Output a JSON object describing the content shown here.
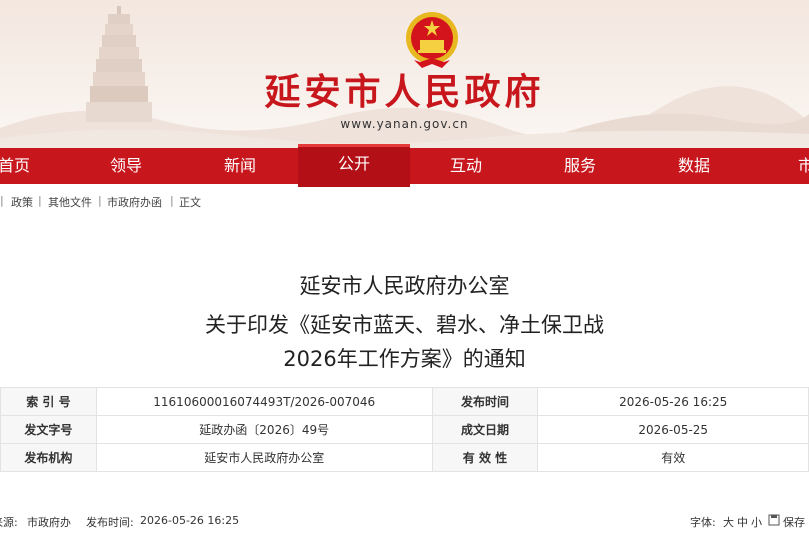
{
  "header": {
    "site_title": "延安市人民政府",
    "site_url": "www.yanan.gov.cn"
  },
  "nav": {
    "items": [
      {
        "label": "首页"
      },
      {
        "label": "领导"
      },
      {
        "label": "新闻"
      },
      {
        "label": "公开",
        "active": true
      },
      {
        "label": "互动"
      },
      {
        "label": "服务"
      },
      {
        "label": "数据"
      },
      {
        "label": "市"
      }
    ]
  },
  "breadcrumb": {
    "items": [
      "政策",
      "其他文件",
      "市政府办函",
      "正文"
    ],
    "separator": "|"
  },
  "document": {
    "title_lines": [
      "延安市人民政府办公室",
      "关于印发《延安市蓝天、碧水、净土保卫战",
      "2026年工作方案》的通知"
    ]
  },
  "info_table": {
    "rows": [
      {
        "label1": "索 引 号",
        "value1": "11610600016074493T/2026-007046",
        "label2": "发布时间",
        "value2": "2026-05-26 16:25"
      },
      {
        "label1": "发文字号",
        "value1": "延政办函〔2026〕49号",
        "label2": "成文日期",
        "value2": "2026-05-25"
      },
      {
        "label1": "发布机构",
        "value1": "延安市人民政府办公室",
        "label2": "有 效 性",
        "value2": "有效"
      }
    ]
  },
  "meta": {
    "source_label": "来源:",
    "source_value": "市政府办",
    "publish_label": "发布时间:",
    "publish_value": "2026-05-26 16:25",
    "font_label": "字体:",
    "font_large": "大",
    "font_medium": "中",
    "font_small": "小",
    "save_label": "保存"
  },
  "colors": {
    "brand_red": "#c8161d",
    "nav_active": "#b30f16"
  }
}
